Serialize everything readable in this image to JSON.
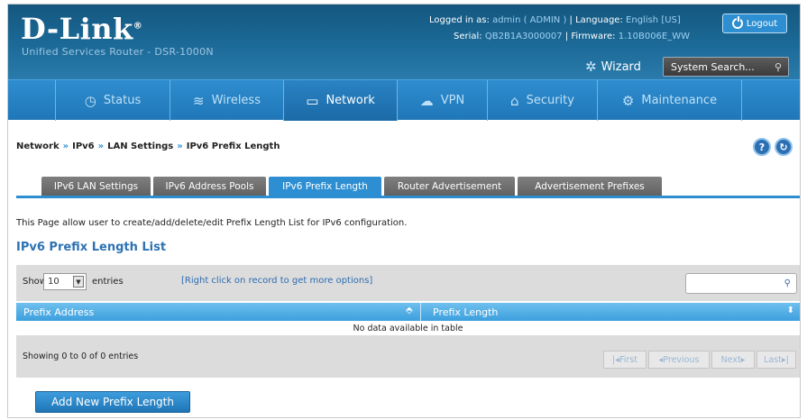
{
  "header": {
    "logo": "D-Link",
    "logo_mark": "®",
    "product": "Unified Services Router - DSR-1000N",
    "logged_in_label": "Logged in as:",
    "logged_in_value": "admin ( ADMIN )",
    "language_label": "Language:",
    "language_value": "English [US]",
    "serial_label": "Serial:",
    "serial_value": "QB2B1A3000007",
    "firmware_label": "Firmware:",
    "firmware_value": "1.10B006E_WW",
    "logout_label": "Logout",
    "wizard_label": "Wizard",
    "system_search_placeholder": "System Search..."
  },
  "nav": [
    {
      "label": "Status",
      "icon": "gauge-icon",
      "glyph": "◷"
    },
    {
      "label": "Wireless",
      "icon": "wifi-icon",
      "glyph": "≋"
    },
    {
      "label": "Network",
      "icon": "monitor-icon",
      "glyph": "▭"
    },
    {
      "label": "VPN",
      "icon": "cloud-icon",
      "glyph": "☁"
    },
    {
      "label": "Security",
      "icon": "lock-icon",
      "glyph": "⌂"
    },
    {
      "label": "Maintenance",
      "icon": "gear-icon",
      "glyph": "⚙"
    }
  ],
  "active_nav": "Network",
  "breadcrumb": [
    "Network",
    "IPv6",
    "LAN Settings",
    "IPv6 Prefix Length"
  ],
  "breadcrumb_sep": "»",
  "tabs": [
    "IPv6 LAN Settings",
    "IPv6 Address Pools",
    "IPv6 Prefix Length",
    "Router Advertisement",
    "Advertisement Prefixes"
  ],
  "active_tab": "IPv6 Prefix Length",
  "intro": "This Page allow user to create/add/delete/edit Prefix Length List for IPv6 configuration.",
  "list_title": "IPv6 Prefix Length List",
  "table": {
    "show_label": "Show",
    "entries_value": "10",
    "entries_label": "entries",
    "hint": "[Right click on record to get more options]",
    "columns": [
      "Prefix Address",
      "Prefix Length"
    ],
    "empty_message": "No data available in table",
    "info": "Showing 0 to 0 of 0 entries",
    "pagination": [
      "First",
      "Previous",
      "Next",
      "Last"
    ]
  },
  "add_button": "Add New Prefix Length",
  "colors": {
    "accent": "#2d8fd1",
    "header": "#1c6a98",
    "tab_inactive": "#6f6f6f"
  }
}
